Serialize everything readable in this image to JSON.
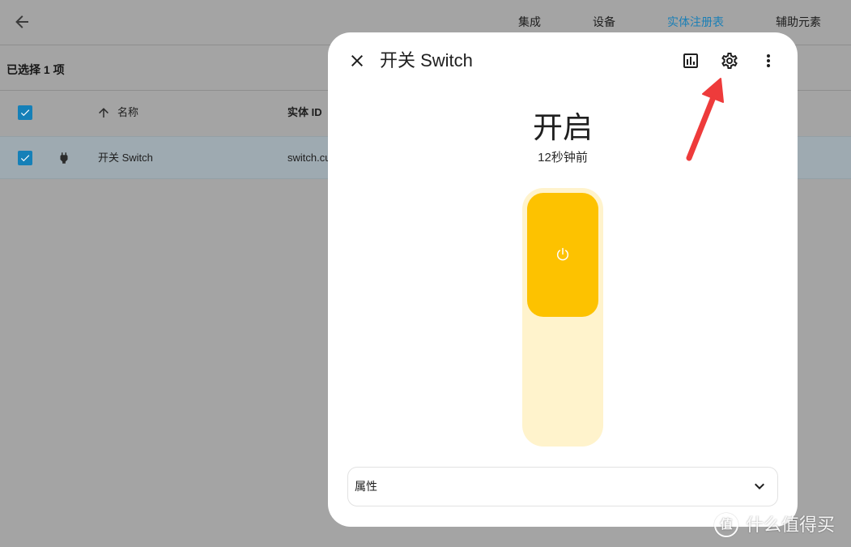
{
  "colors": {
    "backdrop": "#a4a4a4",
    "selected_row": "#9eaab1",
    "divider": "#8e8e8e",
    "accent": "#1580b8",
    "tab_active": "#1b7fb6",
    "toggle_on": "#fdc200",
    "toggle_track": "#fff3cc",
    "annotation_red": "#ee3b3b"
  },
  "background_page": {
    "back_icon": "arrow-left-icon",
    "nav_tabs": [
      {
        "label": "集成",
        "active": false
      },
      {
        "label": "设备",
        "active": false
      },
      {
        "label": "实体注册表",
        "active": true
      },
      {
        "label": "辅助元素",
        "active": false
      }
    ],
    "selection_label": "已选择 1 项",
    "table": {
      "select_all_checked": true,
      "sort_icon": "arrow-up-icon",
      "columns": {
        "name": "名称",
        "entity_id": "实体 ID"
      },
      "rows": [
        {
          "checked": true,
          "icon": "power-plug-icon",
          "name": "开关 Switch",
          "entity_id": "switch.cu"
        }
      ]
    }
  },
  "dialog": {
    "close_icon": "close-icon",
    "title": "开关 Switch",
    "header_actions": [
      {
        "icon": "chart-box-icon"
      },
      {
        "icon": "gear-icon"
      },
      {
        "icon": "dots-vertical-icon"
      }
    ],
    "state": "开启",
    "last_changed": "12秒钟前",
    "toggle": {
      "on": true,
      "icon": "power-icon"
    },
    "attributes_label": "属性",
    "attributes_icon": "chevron-down-icon"
  },
  "watermark": {
    "logo_text": "值",
    "text": "什么值得买"
  }
}
